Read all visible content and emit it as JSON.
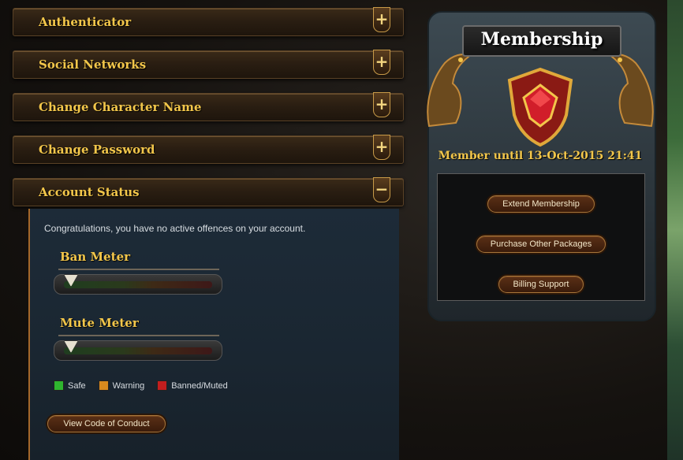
{
  "accordion": {
    "sections": [
      {
        "title": "Authenticator",
        "toggle": "+"
      },
      {
        "title": "Social Networks",
        "toggle": "+"
      },
      {
        "title": "Change Character Name",
        "toggle": "+"
      },
      {
        "title": "Change Password",
        "toggle": "+"
      },
      {
        "title": "Account Status",
        "toggle": "−"
      }
    ]
  },
  "account_status": {
    "message": "Congratulations, you have no active offences on your account.",
    "ban_meter": {
      "label": "Ban Meter",
      "level_percent": 0
    },
    "mute_meter": {
      "label": "Mute Meter",
      "level_percent": 0
    },
    "legend": [
      {
        "label": "Safe",
        "color": "#2fb52f"
      },
      {
        "label": "Warning",
        "color": "#d88a1e"
      },
      {
        "label": "Banned/Muted",
        "color": "#c21e1e"
      }
    ],
    "conduct_button": "View Code of Conduct"
  },
  "membership": {
    "title": "Membership",
    "status": "Member until 13-Oct-2015 21:41",
    "buttons": {
      "extend": "Extend Membership",
      "purchase": "Purchase Other Packages",
      "billing": "Billing Support"
    },
    "emblem_icon": "ruby-shield-icon"
  },
  "colors": {
    "accent_gold": "#f2c64a",
    "panel_blue": "#1d2b38"
  }
}
